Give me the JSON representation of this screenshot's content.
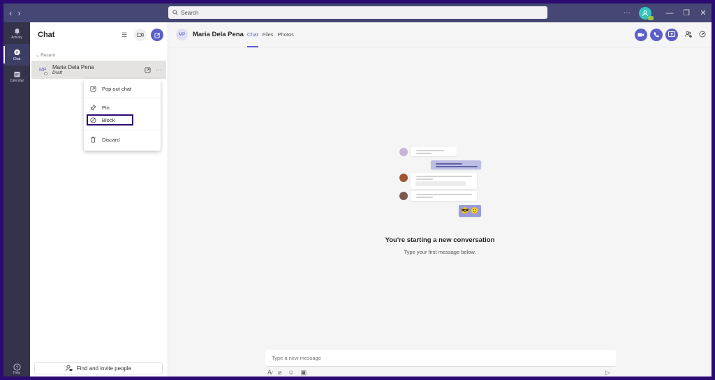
{
  "titlebar": {
    "back_label": "‹",
    "forward_label": "›",
    "search_placeholder": "Search",
    "more_label": "···",
    "minimize": "—",
    "maximize": "❐",
    "close": "✕"
  },
  "rail": {
    "items": [
      {
        "label": "Activity",
        "icon": "bell-icon"
      },
      {
        "label": "Chat",
        "icon": "chat-icon",
        "active": true
      },
      {
        "label": "Calendar",
        "icon": "calendar-icon"
      }
    ],
    "help_label": "Help"
  },
  "panel": {
    "title": "Chat",
    "recent_label": "Recent",
    "chats": [
      {
        "initials": "MP",
        "name": "Maria Dela Pena",
        "preview": "Draft"
      }
    ],
    "find_label": "Find and invite people"
  },
  "context_menu": {
    "items": [
      {
        "label": "Pop out chat",
        "icon": "pop-out-icon"
      },
      {
        "label": "Pin",
        "icon": "pin-icon"
      },
      {
        "label": "Block",
        "icon": "block-icon",
        "highlighted": true
      },
      {
        "label": "Discard",
        "icon": "trash-icon"
      }
    ]
  },
  "main": {
    "initials": "MP",
    "name": "Maria Dela Pena",
    "tabs": [
      {
        "label": "Chat",
        "active": true
      },
      {
        "label": "Files"
      },
      {
        "label": "Photos"
      }
    ],
    "empty_title": "You're starting a new conversation",
    "empty_subtitle": "Type your first message below.",
    "compose_placeholder": "Type a new message"
  },
  "colors": {
    "brand": "#5b5fc7",
    "titlebar": "#464775",
    "rail": "#33344a",
    "frame": "#2b0a72",
    "highlight_box": "#2b0a72"
  }
}
